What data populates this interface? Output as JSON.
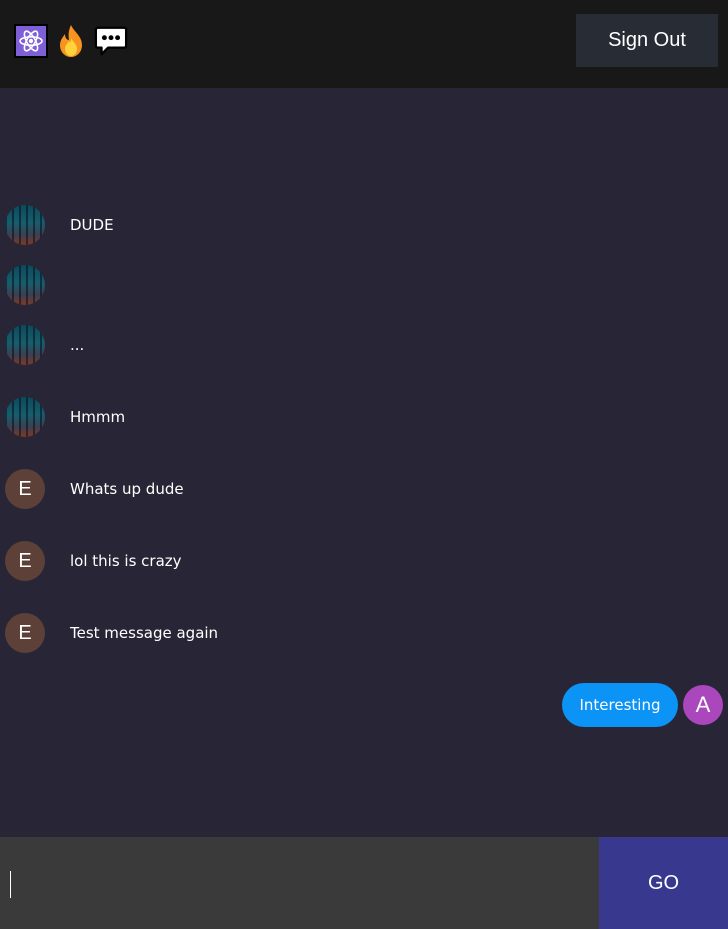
{
  "header": {
    "icons": [
      "atom-icon",
      "fire-icon",
      "speech-bubble-icon"
    ],
    "sign_out_label": "Sign Out"
  },
  "messages": [
    {
      "avatar": "forest-photo",
      "text": "DUDE"
    },
    {
      "avatar": "forest-photo",
      "text": ""
    },
    {
      "avatar": "forest-photo",
      "text": "..."
    },
    {
      "avatar": "forest-photo",
      "text": "Hmmm"
    },
    {
      "avatar": "E",
      "text": "Whats up dude"
    },
    {
      "avatar": "E",
      "text": "lol this is crazy"
    },
    {
      "avatar": "E",
      "text": "Test message again"
    }
  ],
  "sent_message": {
    "text": "Interesting",
    "avatar": "A"
  },
  "composer": {
    "value": "",
    "go_label": "GO"
  },
  "colors": {
    "background": "#282636",
    "header": "#181818",
    "sent_bubble": "#0b93f6",
    "go_button": "#38388f",
    "avatar_e": "#5d4037",
    "avatar_a": "#ab47bc"
  }
}
